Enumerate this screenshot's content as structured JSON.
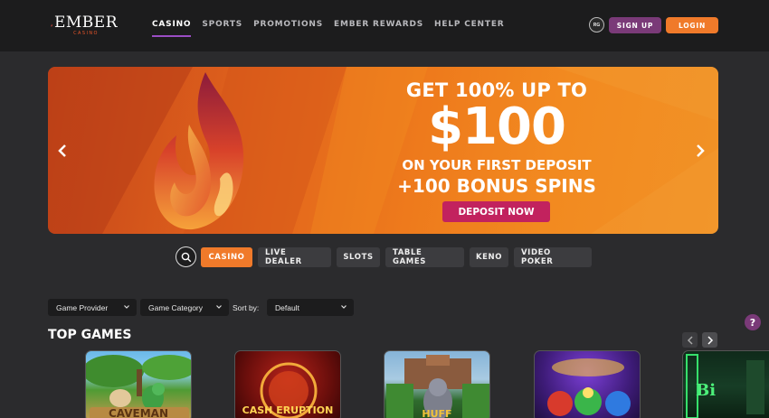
{
  "brand": {
    "name": "EMBER",
    "subtitle": "CASINO",
    "colors": {
      "orange": "#f07a2a",
      "purple": "#7a3a78",
      "pink": "#c2225e"
    }
  },
  "nav": {
    "items": [
      {
        "label": "CASINO",
        "active": true
      },
      {
        "label": "SPORTS",
        "active": false
      },
      {
        "label": "PROMOTIONS",
        "active": false
      },
      {
        "label": "EMBER REWARDS",
        "active": false
      },
      {
        "label": "HELP CENTER",
        "active": false
      }
    ]
  },
  "header": {
    "rg_badge": "RG",
    "signup_label": "SIGN UP",
    "login_label": "LOGIN"
  },
  "hero": {
    "line1": "GET 100% UP TO",
    "line2": "$100",
    "line3": "ON YOUR FIRST DEPOSIT",
    "line4": "+100 BONUS SPINS",
    "cta": "DEPOSIT NOW",
    "prev_icon": "chevron-left-icon",
    "next_icon": "chevron-right-icon"
  },
  "categories": {
    "search_icon": "search-icon",
    "tabs": [
      {
        "label": "CASINO",
        "active": true
      },
      {
        "label": "LIVE DEALER",
        "active": false
      },
      {
        "label": "SLOTS",
        "active": false
      },
      {
        "label": "TABLE GAMES",
        "active": false
      },
      {
        "label": "KENO",
        "active": false
      },
      {
        "label": "VIDEO POKER",
        "active": false
      }
    ]
  },
  "filters": {
    "provider": "Game Provider",
    "category": "Game Category",
    "sort_label": "Sort by:",
    "sort_value": "Default"
  },
  "top_games": {
    "title": "TOP GAMES",
    "help": "?",
    "cards": [
      {
        "label": "CAVEMAN"
      },
      {
        "label": "CASH ERUPTION"
      },
      {
        "label": "HUFF"
      },
      {
        "label": ""
      },
      {
        "label": "Bi"
      }
    ]
  }
}
